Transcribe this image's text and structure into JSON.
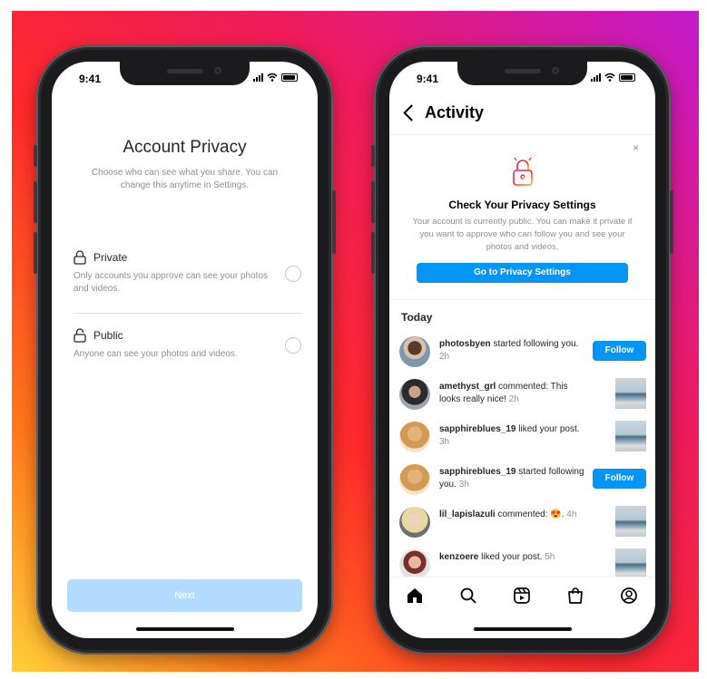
{
  "left_phone": {
    "status_time": "9:41",
    "title": "Account Privacy",
    "description": "Choose who can see what you share. You can change this anytime in Settings.",
    "options": [
      {
        "label": "Private",
        "description": "Only accounts you approve can see your photos and videos.",
        "icon": "lock-icon",
        "selected": false
      },
      {
        "label": "Public",
        "description": "Anyone can see your photos and videos.",
        "icon": "unlock-icon",
        "selected": false
      }
    ],
    "next_label": "Next"
  },
  "right_phone": {
    "status_time": "9:41",
    "header_title": "Activity",
    "close_symbol": "×",
    "prompt": {
      "title": "Check Your Privacy Settings",
      "description": "Your account is currently public. You can make it private if you want to approve who can follow you and see your photos and videos.",
      "button_label": "Go to Privacy Settings"
    },
    "section_title": "Today",
    "follow_label": "Follow",
    "activities": [
      {
        "username": "photosbyen",
        "text": " started following you.",
        "time": "2h",
        "action": "follow"
      },
      {
        "username": "amethyst_grl",
        "text": " commented: This looks really nice!",
        "time": "2h",
        "action": "thumb"
      },
      {
        "username": "sapphireblues_19",
        "text": " liked your post.",
        "time": "3h",
        "action": "thumb"
      },
      {
        "username": "sapphireblues_19",
        "text": " started following you.",
        "time": "3h",
        "action": "follow"
      },
      {
        "username": "lil_lapislazuli",
        "text": " commented: 😍.",
        "time": "4h",
        "action": "thumb"
      },
      {
        "username": "kenzoere",
        "text": " liked your post.",
        "time": "5h",
        "action": "thumb"
      }
    ],
    "nav_items": [
      "home-icon",
      "search-icon",
      "reels-icon",
      "shop-icon",
      "profile-icon"
    ]
  },
  "colors": {
    "accent_blue": "#0095f6",
    "disabled_blue": "#b3dbff"
  }
}
